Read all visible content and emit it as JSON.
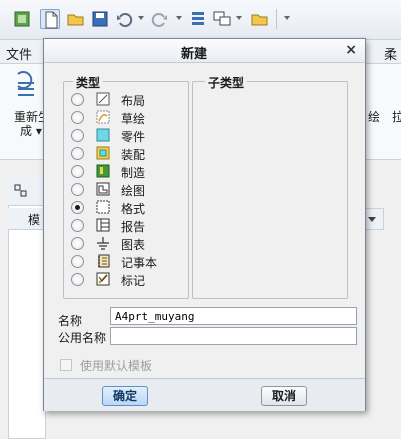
{
  "background": {
    "ribbon_tabs": [
      "文件",
      "柔"
    ],
    "ribbon_labels": {
      "regenerate": "重新生",
      "regenerate_line2": "成 ▾",
      "right_label": "绘",
      "right_label_2": "拉"
    },
    "model_tree_header": "模"
  },
  "dialog": {
    "title": "新建",
    "close_glyph": "×",
    "type_group_label": "类型",
    "subtype_group_label": "子类型",
    "types": [
      {
        "label": "布局",
        "icon": "layout-icon",
        "checked": false
      },
      {
        "label": "草绘",
        "icon": "sketch-icon",
        "checked": false
      },
      {
        "label": "零件",
        "icon": "part-icon",
        "checked": false
      },
      {
        "label": "装配",
        "icon": "assembly-icon",
        "checked": false
      },
      {
        "label": "制造",
        "icon": "manufacturing-icon",
        "checked": false
      },
      {
        "label": "绘图",
        "icon": "drawing-icon",
        "checked": false
      },
      {
        "label": "格式",
        "icon": "format-icon",
        "checked": true
      },
      {
        "label": "报告",
        "icon": "report-icon",
        "checked": false
      },
      {
        "label": "图表",
        "icon": "diagram-icon",
        "checked": false
      },
      {
        "label": "记事本",
        "icon": "notebook-icon",
        "checked": false
      },
      {
        "label": "标记",
        "icon": "markup-icon",
        "checked": false
      }
    ],
    "name_label": "名称",
    "name_value": "A4prt_muyang",
    "common_name_label": "公用名称",
    "common_name_value": "",
    "use_default_template_label": "使用默认模板",
    "ok_label": "确定",
    "cancel_label": "取消"
  }
}
